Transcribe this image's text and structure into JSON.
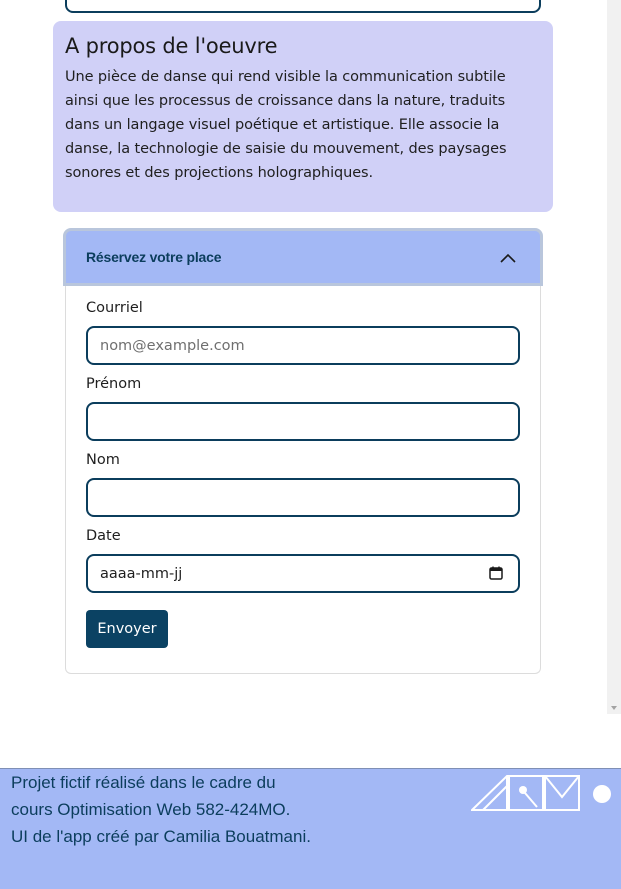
{
  "about": {
    "heading": "A propos de l'oeuvre",
    "description": "Une pièce de danse qui rend visible la communication subtile ainsi que les processus de croissance dans la nature, traduits dans un langage visuel poétique et artistique. Elle associe la danse, la technologie de saisie du mouvement, des paysages sonores et des projections holographiques."
  },
  "booking": {
    "title": "Réservez votre place",
    "expanded": true,
    "fields": {
      "email_label": "Courriel",
      "email_placeholder": "nom@example.com",
      "firstname_label": "Prénom",
      "firstname_value": "",
      "lastname_label": "Nom",
      "lastname_value": "",
      "date_label": "Date",
      "date_placeholder": "aaaa-mm-jj"
    },
    "submit_label": "Envoyer"
  },
  "footer": {
    "text": "Projet fictif réalisé dans le cadre du cours Optimisation Web 582-424MO. UI de l'app créé par Camilia Bouatmani."
  },
  "colors": {
    "about_bg": "#d0d0f7",
    "accordion_header_bg": "#a3b8f5",
    "primary": "#0b3d5c",
    "button_bg": "#0b4263",
    "footer_bg": "#a3b8f5"
  },
  "icons": [
    "chevron-up-icon",
    "calendar-icon",
    "logo"
  ]
}
